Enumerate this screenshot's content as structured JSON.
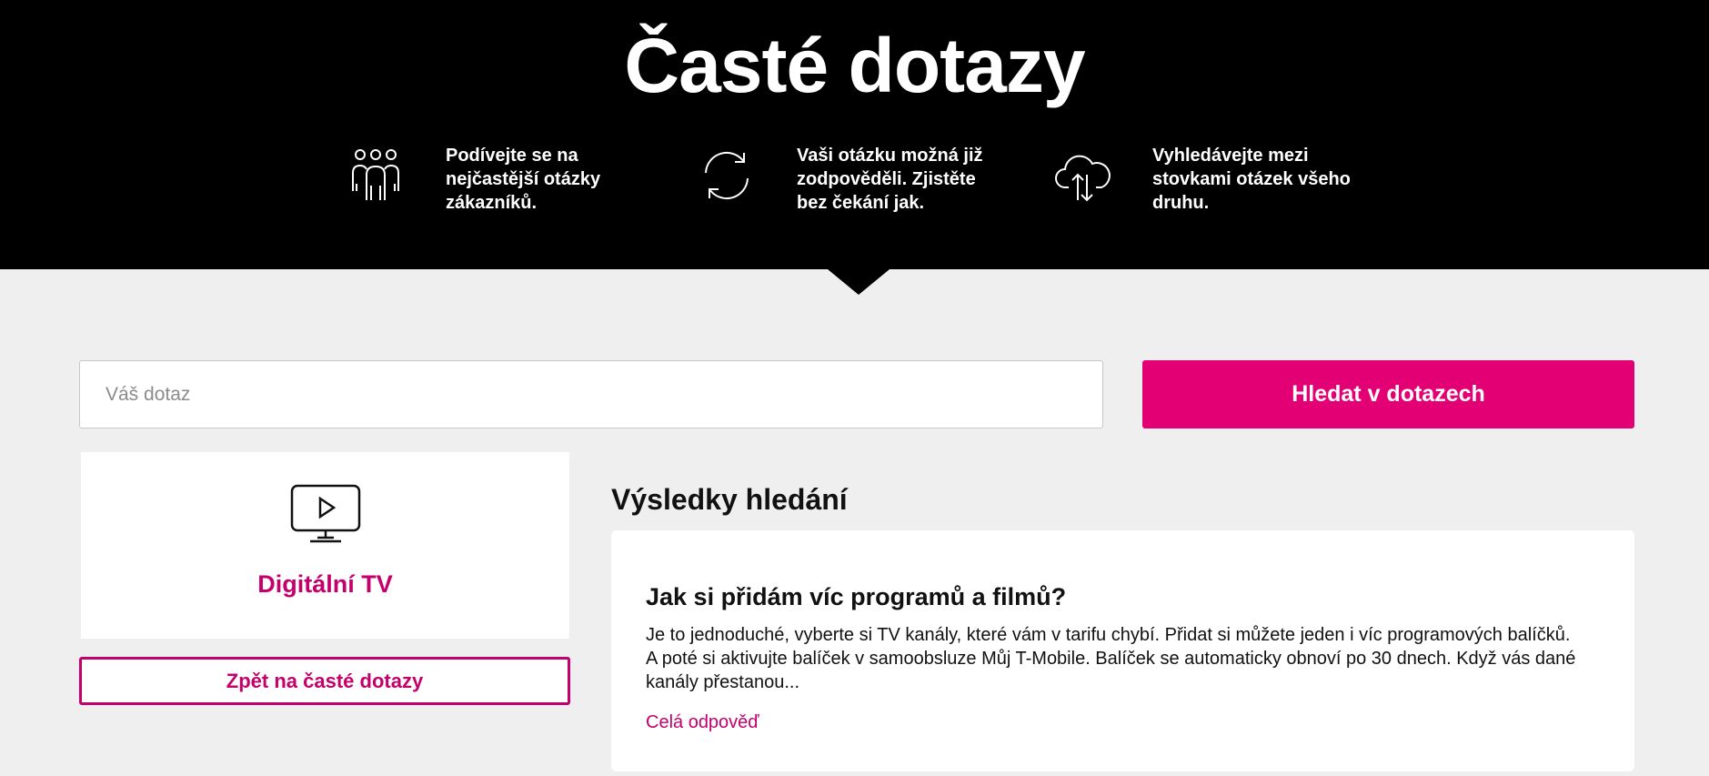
{
  "hero": {
    "title": "Časté dotazy",
    "features": [
      {
        "icon": "people-icon",
        "text": "Podívejte se na nejčastější otázky zákazníků."
      },
      {
        "icon": "refresh-icon",
        "text": "Vaši otázku možná již zodpověděli. Zjistěte bez čekání jak."
      },
      {
        "icon": "cloud-transfer-icon",
        "text": "Vyhledávejte mezi stovkami otázek všeho druhu."
      }
    ]
  },
  "search": {
    "placeholder": "Váš dotaz",
    "value": "",
    "button_label": "Hledat v dotazech"
  },
  "category": {
    "icon": "tv-play-icon",
    "label": "Digitální TV",
    "back_label": "Zpět na časté dotazy"
  },
  "results": {
    "heading": "Výsledky hledání",
    "items": [
      {
        "title": "Jak si přidám víc programů a filmů?",
        "text": "Je to jednoduché, vyberte si TV kanály, které vám v tarifu chybí. Přidat si můžete jeden i víc programových balíčků. A poté si aktivujte balíček v samoobsluze Můj T-Mobile. Balíček se automaticky obnoví po 30 dnech. Když vás dané kanály přestanou...",
        "link_label": "Celá odpověď"
      }
    ]
  },
  "colors": {
    "brand": "#e20074",
    "brand_text": "#c4006d",
    "header_bg": "#000000",
    "page_bg": "#efefef"
  }
}
